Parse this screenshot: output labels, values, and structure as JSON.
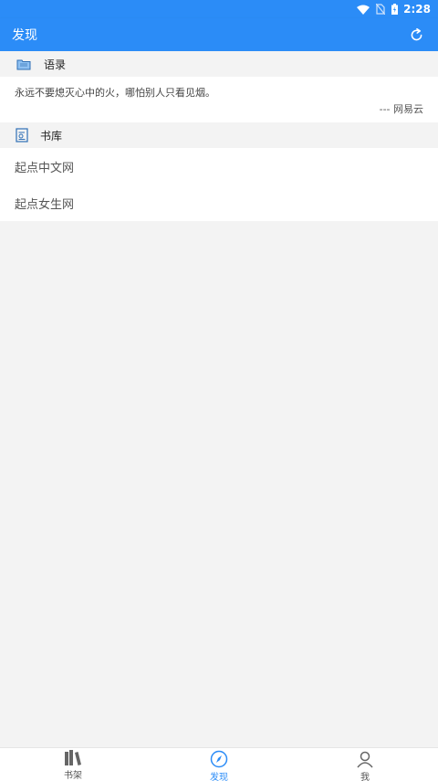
{
  "status_bar": {
    "time": "2:28",
    "icons": [
      "wifi-icon",
      "no-sim-icon",
      "battery-charging-icon"
    ]
  },
  "app_bar": {
    "title": "发现",
    "action_icon": "refresh-icon"
  },
  "quotes_section": {
    "header_icon": "folder-icon",
    "header_label": "语录",
    "quote_text": "永远不要熄灭心中的火，哪怕别人只看见烟。",
    "quote_source": "--- 网易云"
  },
  "library_section": {
    "header_icon": "library-icon",
    "header_label": "书库",
    "items": [
      {
        "label": "起点中文网"
      },
      {
        "label": "起点女生网"
      }
    ]
  },
  "bottom_nav": {
    "items": [
      {
        "label": "书架",
        "icon": "bookshelf-icon",
        "active": false
      },
      {
        "label": "发现",
        "icon": "compass-icon",
        "active": true
      },
      {
        "label": "我",
        "icon": "person-icon",
        "active": false
      }
    ]
  },
  "colors": {
    "primary": "#2b8cf7",
    "background": "#f3f3f3",
    "card": "#ffffff"
  }
}
